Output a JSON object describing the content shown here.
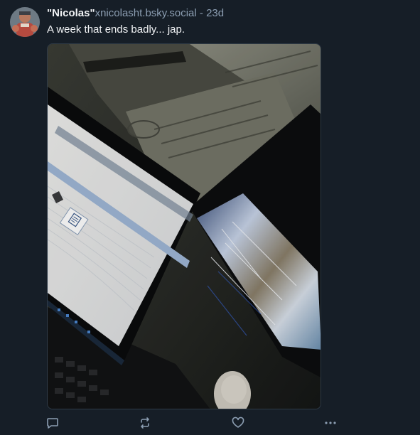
{
  "post": {
    "author": {
      "display_name": "\"Nicolas\"",
      "handle": "xnicolasht.bsky.social",
      "separator": " - ",
      "time": "23d"
    },
    "text": "A week that ends badly... jap.",
    "image": {
      "description_icon": "photo-of-cracked-laptop-screen",
      "screen_label_1": "LECTURE SEULE",
      "screen_label_2": "Contrôle à distance"
    },
    "actions": {
      "reply_icon": "reply-icon",
      "repost_icon": "repost-icon",
      "like_icon": "heart-icon",
      "more_icon": "more-icon"
    }
  },
  "colors": {
    "background": "#161e27",
    "text": "#f1f3f5",
    "muted": "#8c9eb2"
  }
}
